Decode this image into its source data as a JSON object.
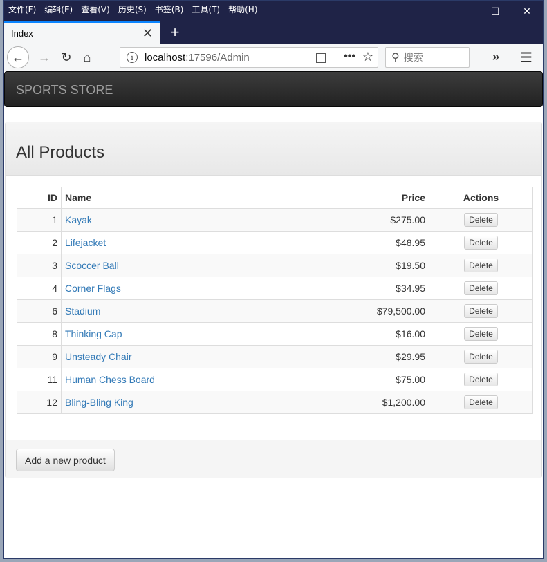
{
  "menubar": [
    "文件(F)",
    "编辑(E)",
    "查看(V)",
    "历史(S)",
    "书签(B)",
    "工具(T)",
    "帮助(H)"
  ],
  "window_controls": {
    "minimize": "—",
    "maximize": "☐",
    "close": "✕"
  },
  "tab": {
    "title": "Index",
    "close": "✕",
    "new": "+"
  },
  "address": {
    "host": "localhost",
    "path": ":17596/Admin"
  },
  "search": {
    "placeholder": "搜索"
  },
  "site": {
    "brand": "SPORTS STORE"
  },
  "page": {
    "title": "All Products"
  },
  "table": {
    "headers": {
      "id": "ID",
      "name": "Name",
      "price": "Price",
      "actions": "Actions"
    },
    "rows": [
      {
        "id": "1",
        "name": "Kayak",
        "price": "$275.00"
      },
      {
        "id": "2",
        "name": "Lifejacket",
        "price": "$48.95"
      },
      {
        "id": "3",
        "name": "Scoccer Ball",
        "price": "$19.50"
      },
      {
        "id": "4",
        "name": "Corner Flags",
        "price": "$34.95"
      },
      {
        "id": "6",
        "name": "Stadium",
        "price": "$79,500.00"
      },
      {
        "id": "8",
        "name": "Thinking Cap",
        "price": "$16.00"
      },
      {
        "id": "9",
        "name": "Unsteady Chair",
        "price": "$29.95"
      },
      {
        "id": "11",
        "name": "Human Chess Board",
        "price": "$75.00"
      },
      {
        "id": "12",
        "name": "Bling-Bling King",
        "price": "$1,200.00"
      }
    ],
    "delete_label": "Delete"
  },
  "footer": {
    "add_label": "Add a new product"
  },
  "colors": {
    "link": "#337ab7",
    "brand_bar": "#222222",
    "title_bar": "#1f2347"
  }
}
